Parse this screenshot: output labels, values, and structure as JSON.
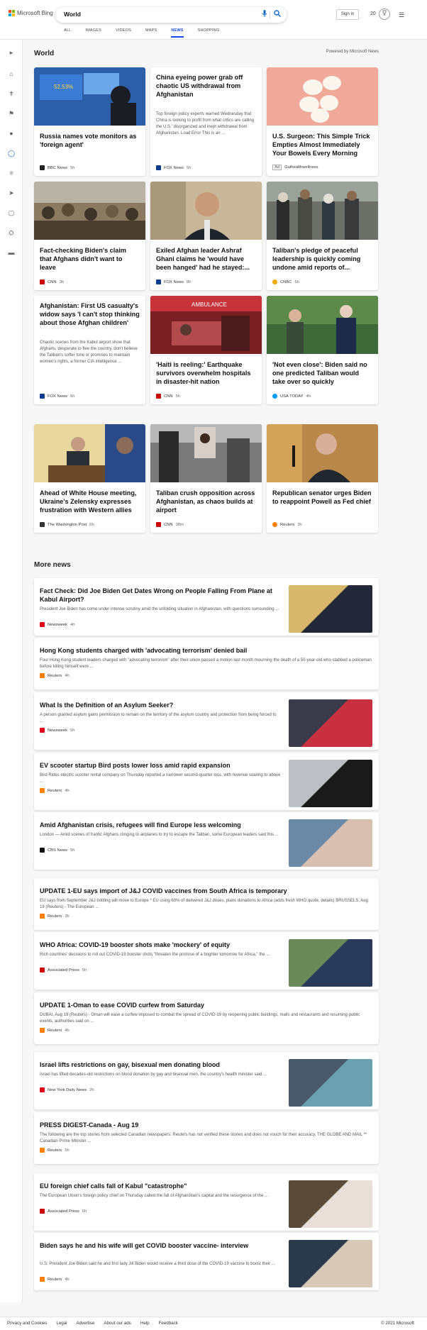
{
  "header": {
    "brand": "Microsoft Bing",
    "query": "World",
    "signin": "Sign in",
    "points": "20",
    "tabs": [
      "ALL",
      "IMAGES",
      "VIDEOS",
      "MAPS",
      "NEWS",
      "SHOPPING"
    ],
    "active_tab": "NEWS"
  },
  "section": {
    "title": "World",
    "powered": "Powered by Microsoft News"
  },
  "cards": [
    {
      "title": "Russia names vote monitors as 'foreign agent'",
      "snippet": "",
      "source": "BBC News",
      "time": "5h",
      "color": "#222"
    },
    {
      "title": "China eyeing power grab off chaotic US withdrawal from Afghanistan",
      "snippet": "Top foreign policy experts warned Wednesday that China is looking to profit from what critics are calling the U.S.' disorganized and inept withdrawal from Afghanistan. Load Error This is an ...",
      "source": "FOX News",
      "time": "5h",
      "color": "#0b3b8c"
    },
    {
      "title": "U.S. Surgeon: This Simple Trick Empties Almost Immediately Your Bowels Every Morning",
      "snippet": "",
      "source": "Guthealthwellness",
      "time": "",
      "ad": "Ad",
      "color": "#ffffff"
    },
    {
      "title": "Fact-checking Biden's claim that Afghans didn't want to leave",
      "snippet": "",
      "source": "CNN",
      "time": "3h",
      "color": "#cc0000"
    },
    {
      "title": "Exiled Afghan leader Ashraf Ghani claims he 'would have been hanged' had he stayed:...",
      "snippet": "",
      "source": "FOX News",
      "time": "8h",
      "color": "#0b3b8c"
    },
    {
      "title": "Taliban's pledge of peaceful leadership is quickly coming undone amid reports of...",
      "snippet": "",
      "source": "CNBC",
      "time": "6h",
      "color": "#f2a900"
    },
    {
      "title": "Afghanistan: First US casualty's widow says 'I can't stop thinking about those Afghan children'",
      "snippet": "Chaotic scenes from the Kabul airport show that Afghans, desperate to flee the country, don't believe the Taliban's softer tone or promises to maintain women's rights, a former CIA intelligence ...",
      "source": "FOX News",
      "time": "6h",
      "color": "#0b3b8c"
    },
    {
      "title": "'Haiti is reeling:' Earthquake survivors overwhelm hospitals in disaster-hit nation",
      "snippet": "",
      "source": "CNN",
      "time": "5h",
      "color": "#cc0000"
    },
    {
      "title": "'Not even close': Biden said no one predicted Taliban would take over so quickly",
      "snippet": "",
      "source": "USA TODAY",
      "time": "4h",
      "color": "#009bff"
    },
    {
      "title": "Ahead of White House meeting, Ukraine's Zelensky expresses frustration with Western allies",
      "snippet": "",
      "source": "The Washington Post",
      "time": "6h",
      "color": "#333"
    },
    {
      "title": "Taliban crush opposition across Afghanistan, as chaos builds at airport",
      "snippet": "",
      "source": "CNN",
      "time": "38m",
      "color": "#cc0000"
    },
    {
      "title": "Republican senator urges Biden to reappoint Powell as Fed chief",
      "snippet": "",
      "source": "Reuters",
      "time": "2h",
      "color": "#ff8000"
    }
  ],
  "more": {
    "title": "More news",
    "items": [
      {
        "title": "Fact Check: Did Joe Biden Get Dates Wrong on People Falling From Plane at Kabul Airport?",
        "snippet": "President Joe Biden has come under intense scrutiny amid the unfolding situation in Afghanistan, with questions surrounding ...",
        "source": "Newsweek",
        "time": "4h",
        "color": "#e0001b",
        "thumb": true
      },
      {
        "title": "Hong Kong students charged with 'advocating terrorism' denied bail",
        "snippet": "Four Hong Kong student leaders charged with \"advocating terrorism\" after their union passed a motion last month mourning the death of a 50-year-old who stabbed a policeman before killing himself were ...",
        "source": "Reuters",
        "time": "4h",
        "color": "#ff8000",
        "thumb": false
      },
      {
        "title": "What Is the Definition of an Asylum Seeker?",
        "snippet": "A person granted asylum gains permission to remain on the territory of the asylum country and protection from being forced to ...",
        "source": "Newsweek",
        "time": "5h",
        "color": "#e0001b",
        "thumb": true
      },
      {
        "title": "EV scooter startup Bird posts lower loss amid rapid expansion",
        "snippet": "Bird Rides electric scooter rental company on Thursday reported a narrower second-quarter loss, with revenue soaring to above ...",
        "source": "Reuters",
        "time": "4h",
        "color": "#ff8000",
        "thumb": true
      },
      {
        "title": "Amid Afghanistan crisis, refugees will find Europe less welcoming",
        "snippet": "London — Amid scenes of frantic Afghans clinging to airplanes to try to escape the Taliban, some European leaders said this ...",
        "source": "CBS News",
        "time": "5h",
        "color": "#111",
        "thumb": true
      },
      {
        "title": "UPDATE 1-EU says import of J&J COVID vaccines from South Africa is temporary",
        "snippet": "EU says from September J&J bottling will move to Europe * EU using 60% of delivered J&J doses, plans donations to Africa (adds fresh WHO quote, details) BRUSSELS, Aug 19 (Reuters) - The European ...",
        "source": "Reuters",
        "time": "3h",
        "color": "#ff8000",
        "thumb": false
      },
      {
        "title": "WHO Africa: COVID-19 booster shots make 'mockery' of equity",
        "snippet": "Rich countries' decisions to roll out COVID-19 booster shots \"threaten the promise of a brighter tomorrow for Africa,\" the ...",
        "source": "Associated Press",
        "time": "5h",
        "color": "#cc0000",
        "thumb": true
      },
      {
        "title": "UPDATE 1-Oman to ease COVID curfew from Saturday",
        "snippet": "DUBAI, Aug 19 (Reuters) - Oman will ease a curfew imposed to combat the spread of COVID-19 by reopening public buildings, malls and restaurants and resuming public events, authorities said on ...",
        "source": "Reuters",
        "time": "4h",
        "color": "#ff8000",
        "thumb": false
      },
      {
        "title": "Israel lifts restrictions on gay, bisexual men donating blood",
        "snippet": "Israel has lifted decades-old restrictions on blood donation by gay and bisexual men, the country's health minister said ...",
        "source": "New York Daily News",
        "time": "2h",
        "color": "#e0001b",
        "thumb": true
      },
      {
        "title": "PRESS DIGEST-Canada - Aug 19",
        "snippet": "The following are the top stories from selected Canadian newspapers. Reuters has not verified these stories and does not vouch for their accuracy. THE GLOBE AND MAIL ** Canadian Prime Minister ...",
        "source": "Reuters",
        "time": "5h",
        "color": "#ff8000",
        "thumb": false
      },
      {
        "title": "EU foreign chief calls fall of Kabul \"catastrophe\"",
        "snippet": "The European Union's foreign policy chief on Thursday called the fall of Afghanistan's capital and the resurgence of the ...",
        "source": "Associated Press",
        "time": "6h",
        "color": "#cc0000",
        "thumb": true
      },
      {
        "title": "Biden says he and his wife will get COVID booster vaccine- interview",
        "snippet": "U.S. President Joe Biden said he and first lady Jill Biden would receive a third dose of the COVID-19 vaccine to boost their ...",
        "source": "Reuters",
        "time": "4h",
        "color": "#ff8000",
        "thumb": true
      }
    ]
  },
  "footer": {
    "links": [
      "Privacy and Cookies",
      "Legal",
      "Advertise",
      "About our ads",
      "Help",
      "Feedback"
    ],
    "copyright": "© 2021 Microsoft"
  }
}
